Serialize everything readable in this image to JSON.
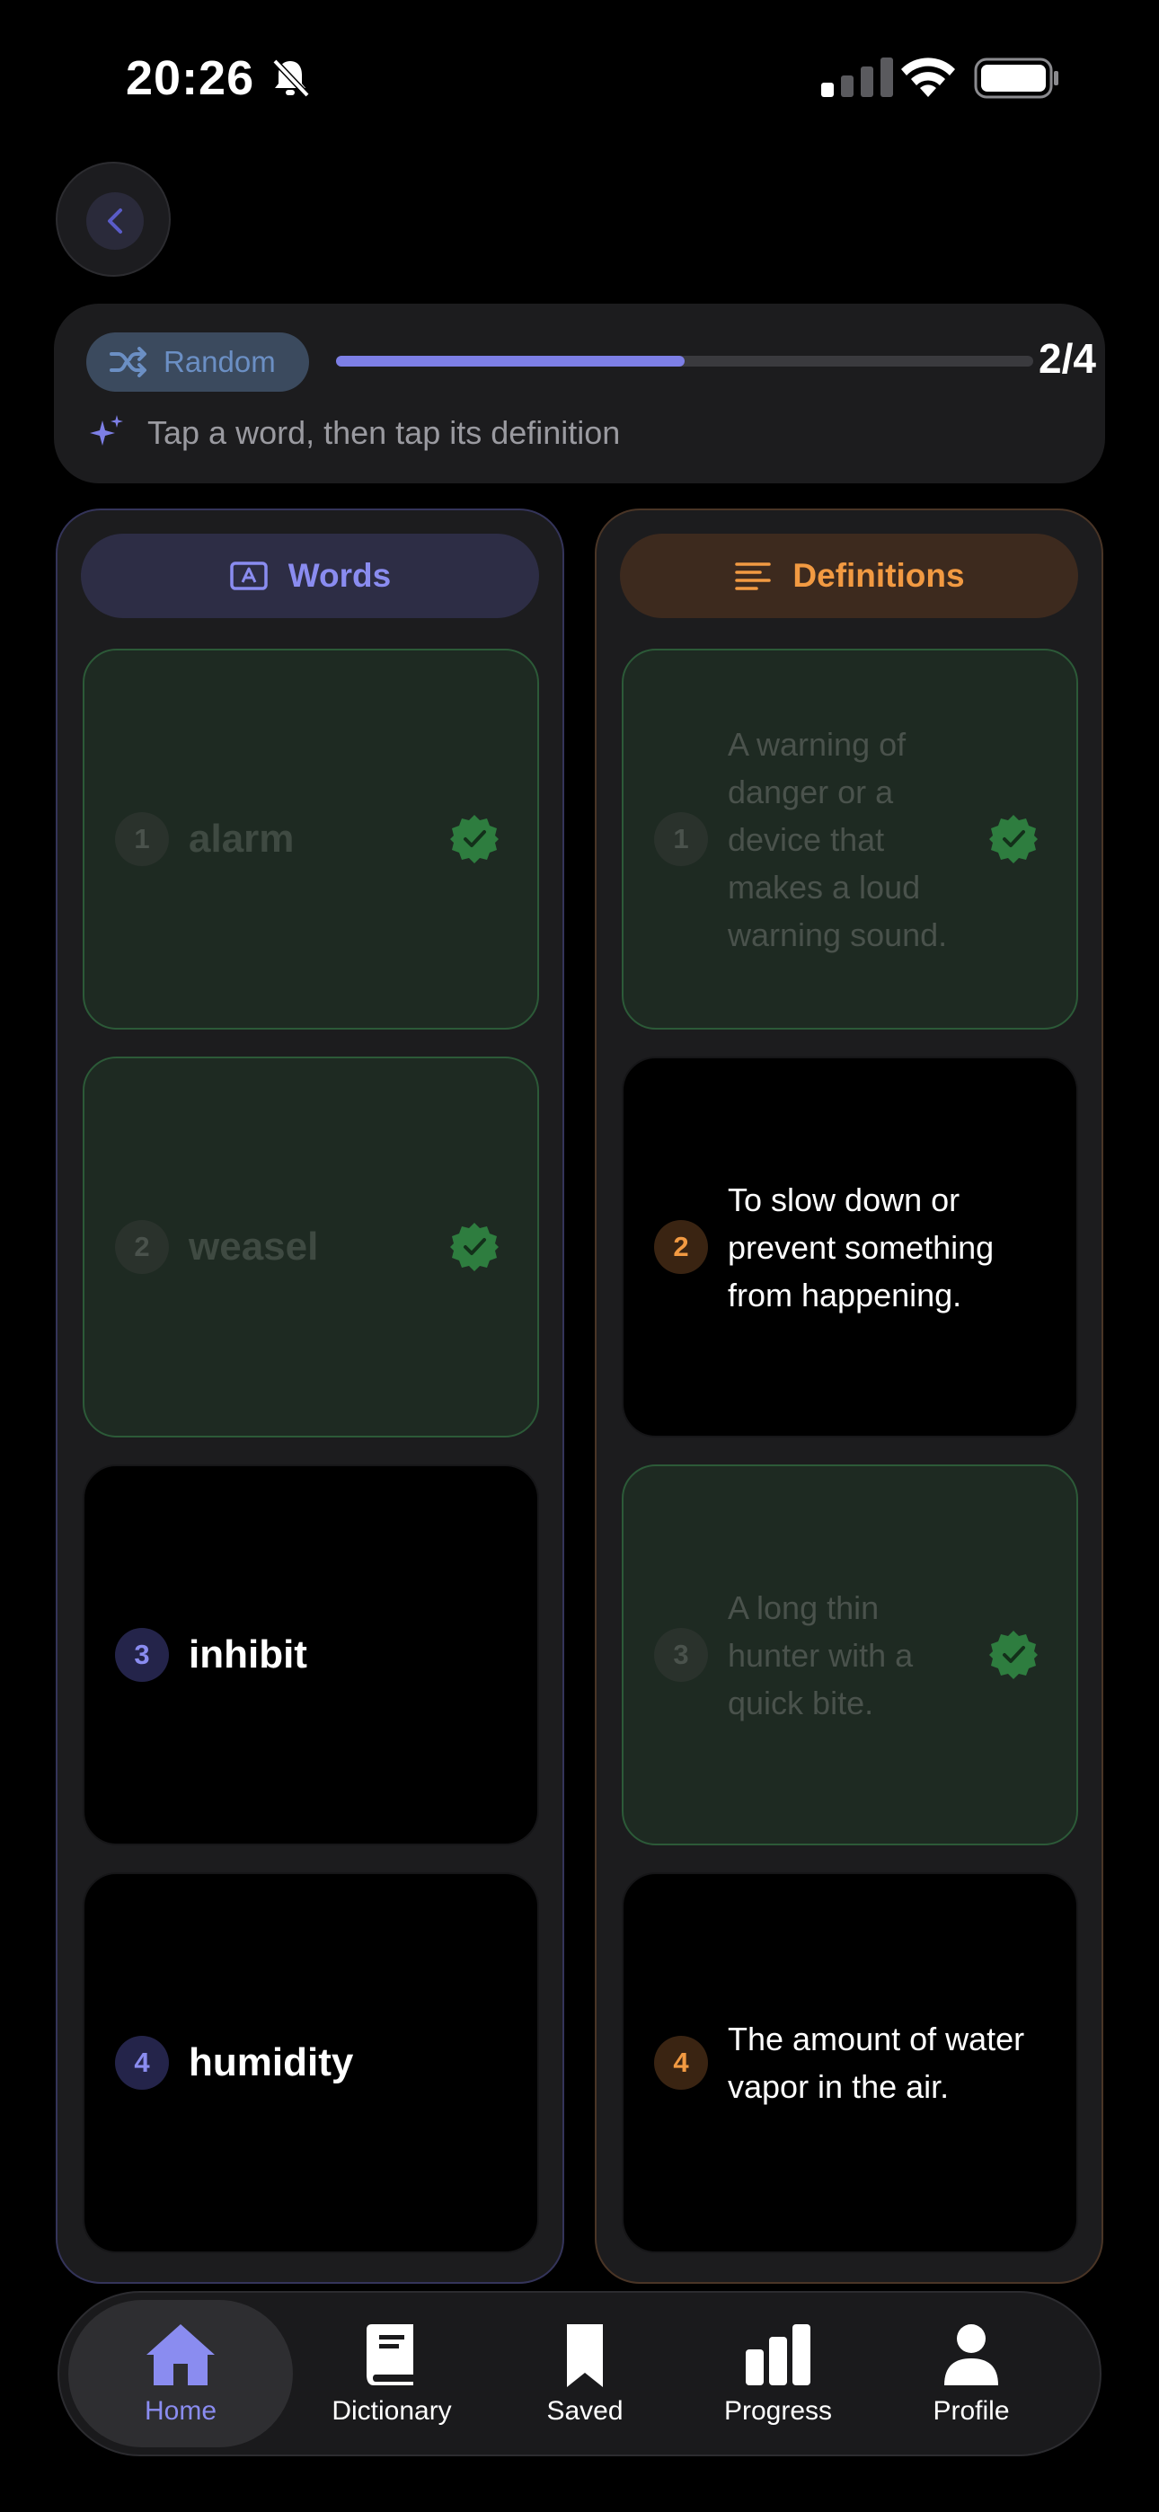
{
  "status_bar": {
    "time": "20:26",
    "icons": [
      "bell-slash-icon",
      "cellular-signal-icon",
      "wifi-icon",
      "battery-icon"
    ]
  },
  "back_button": {
    "icon": "chevron-left-icon"
  },
  "session": {
    "mode_label": "Random",
    "mode_icon": "shuffle-icon",
    "progress_fraction": 0.5,
    "counter": "2/4",
    "hint_icon": "sparkles-icon",
    "hint": "Tap a word, then tap its definition"
  },
  "words_column": {
    "title": "Words",
    "icon": "vocabulary-icon",
    "accent": "#8A8CF0",
    "items": [
      {
        "number": "1",
        "word": "alarm",
        "matched": true
      },
      {
        "number": "2",
        "word": "weasel",
        "matched": true
      },
      {
        "number": "3",
        "word": "inhibit",
        "matched": false
      },
      {
        "number": "4",
        "word": "humidity",
        "matched": false
      }
    ]
  },
  "definitions_column": {
    "title": "Definitions",
    "icon": "text-lines-icon",
    "accent": "#F29A42",
    "items": [
      {
        "number": "1",
        "text": "A warning of danger or a device that makes a loud warning sound.",
        "matched": true
      },
      {
        "number": "2",
        "text": "To slow down or prevent something from happening.",
        "matched": false
      },
      {
        "number": "3",
        "text": "A long thin hunter with a quick bite.",
        "matched": true
      },
      {
        "number": "4",
        "text": "The amount of water vapor in the air.",
        "matched": false
      }
    ]
  },
  "tab_bar": {
    "selected": "Home",
    "tabs": [
      {
        "label": "Home",
        "icon": "house-icon"
      },
      {
        "label": "Dictionary",
        "icon": "book-icon"
      },
      {
        "label": "Saved",
        "icon": "bookmark-icon"
      },
      {
        "label": "Progress",
        "icon": "bar-chart-icon"
      },
      {
        "label": "Profile",
        "icon": "person-icon"
      }
    ]
  },
  "colors": {
    "matched_border": "#2C5A38",
    "matched_check": "#2E7D3F",
    "progress": "#7D7FE6"
  }
}
